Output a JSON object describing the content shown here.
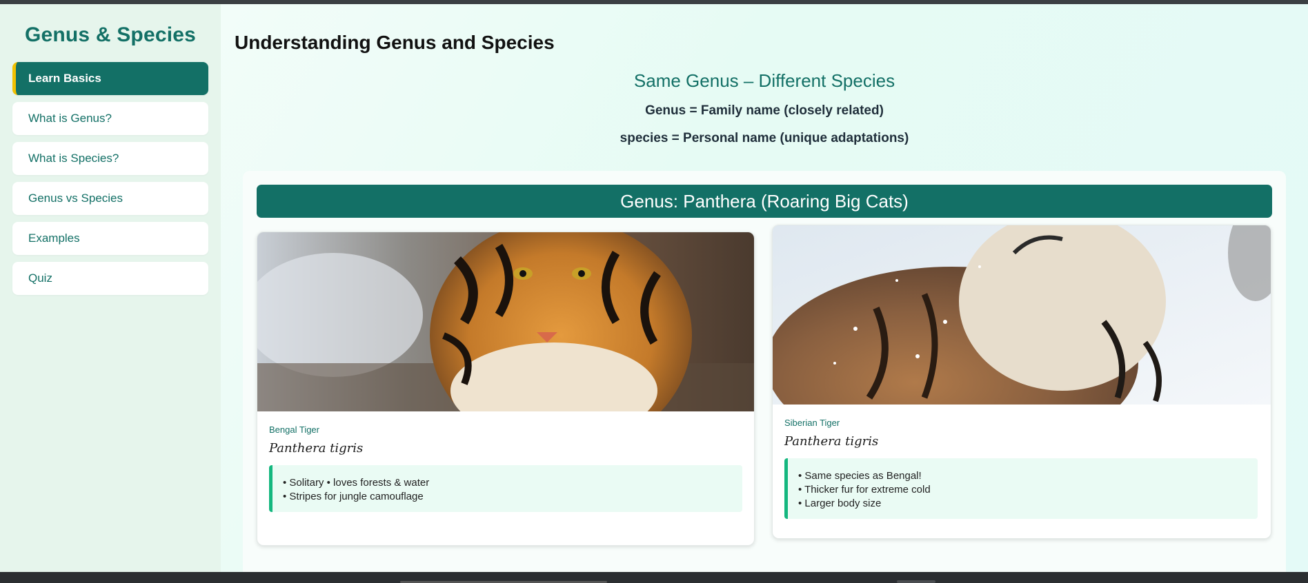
{
  "sidebar": {
    "brand": "Genus & Species",
    "items": [
      {
        "label": "Learn Basics",
        "active": true
      },
      {
        "label": "What is Genus?"
      },
      {
        "label": "What is Species?"
      },
      {
        "label": "Genus vs Species"
      },
      {
        "label": "Examples"
      },
      {
        "label": "Quiz"
      }
    ]
  },
  "main": {
    "title": "Understanding Genus and Species",
    "subtitle": "Same Genus – Different Species",
    "rules": [
      "Genus = Family name (closely related)",
      "species = Personal name (unique adaptations)"
    ],
    "genus_header": "Genus: Panthera (Roaring Big Cats)",
    "cards": [
      {
        "common_name": "Bengal Tiger",
        "scientific_name": "Panthera tigris",
        "facts": [
          "• Solitary • loves forests & water",
          "• Stripes for jungle camouflage"
        ]
      },
      {
        "common_name": "Siberian Tiger",
        "scientific_name": "Panthera tigris",
        "facts": [
          "• Same species as Bengal!",
          "• Thicker fur for extreme cold",
          "• Larger body size"
        ]
      }
    ]
  },
  "colors": {
    "accent": "#137066",
    "active_marker": "#f2c100",
    "fact_border": "#14b77f",
    "fact_bg": "#eafbf4"
  }
}
